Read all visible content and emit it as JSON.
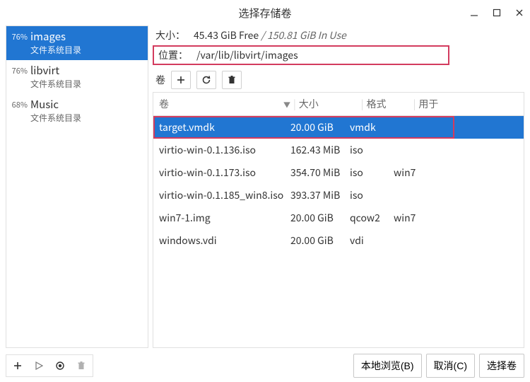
{
  "window": {
    "title": "选择存储卷"
  },
  "pools": [
    {
      "percent": "76%",
      "name": "images",
      "sub": "文件系统目录",
      "selected": true
    },
    {
      "percent": "76%",
      "name": "libvirt",
      "sub": "文件系统目录",
      "selected": false
    },
    {
      "percent": "68%",
      "name": "Music",
      "sub": "文件系统目录",
      "selected": false
    }
  ],
  "info": {
    "size_label": "大小：",
    "free": "45.43 GiB Free",
    "divider": "/",
    "in_use": "150.81 GiB In Use",
    "location_label": "位置：",
    "location_path": "/var/lib/libvirt/images"
  },
  "toolbar": {
    "vol_label": "卷"
  },
  "table": {
    "headers": {
      "vol": "卷",
      "size": "大小",
      "format": "格式",
      "used": "用于"
    },
    "rows": [
      {
        "vol": "target.vmdk",
        "size": "20.00 GiB",
        "format": "vmdk",
        "used": "",
        "selected": true
      },
      {
        "vol": "virtio-win-0.1.136.iso",
        "size": "162.43 MiB",
        "format": "iso",
        "used": ""
      },
      {
        "vol": "virtio-win-0.1.173.iso",
        "size": "354.70 MiB",
        "format": "iso",
        "used": "win7"
      },
      {
        "vol": "virtio-win-0.1.185_win8.iso",
        "size": "393.37 MiB",
        "format": "iso",
        "used": ""
      },
      {
        "vol": "win7-1.img",
        "size": "20.00 GiB",
        "format": "qcow2",
        "used": "win7"
      },
      {
        "vol": "windows.vdi",
        "size": "20.00 GiB",
        "format": "vdi",
        "used": ""
      }
    ]
  },
  "buttons": {
    "browse": "本地浏览(B)",
    "cancel": "取消(C)",
    "select": "选择卷"
  }
}
